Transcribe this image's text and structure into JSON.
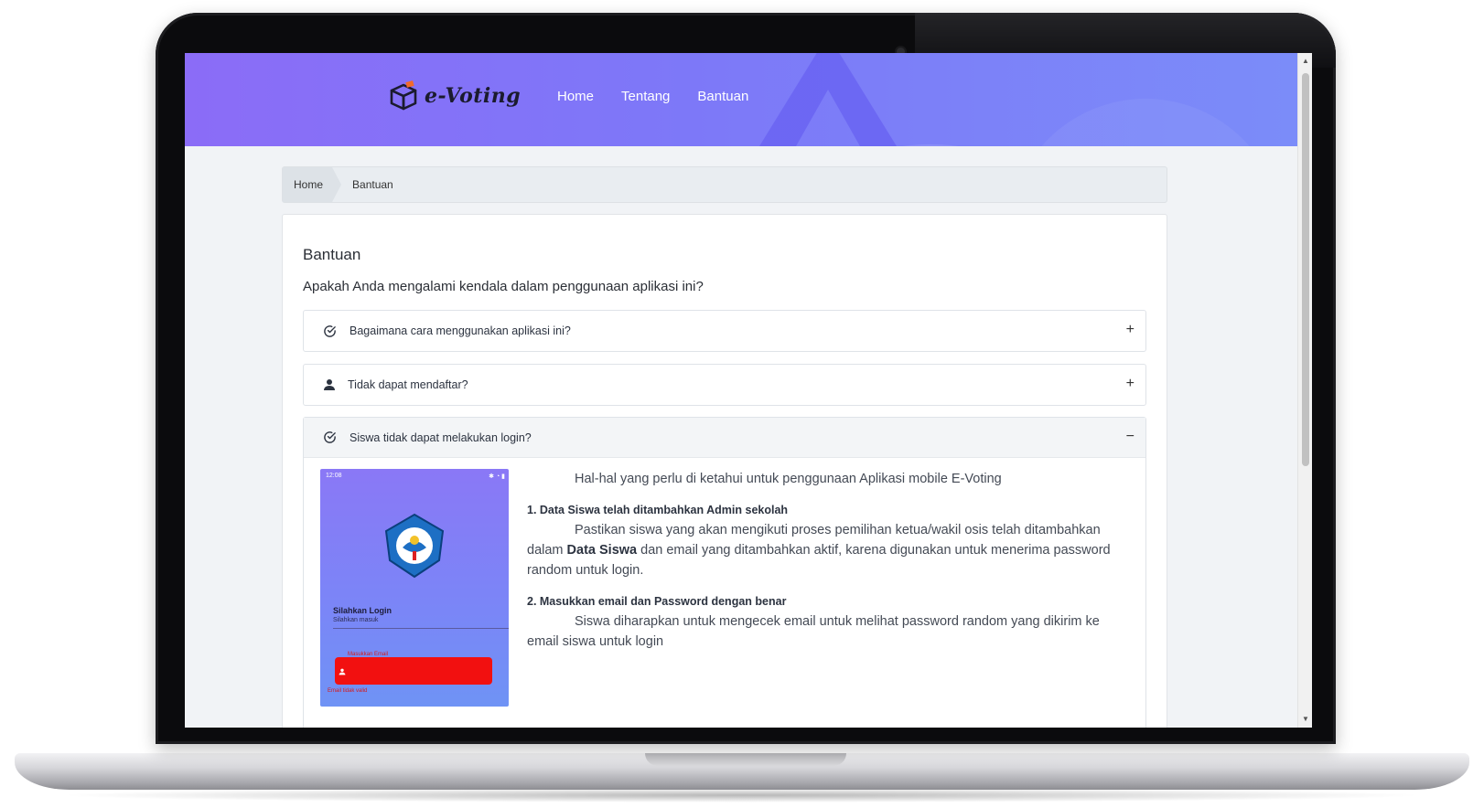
{
  "brand": {
    "logo_text": "e-Voting"
  },
  "nav": {
    "items": [
      "Home",
      "Tentang",
      "Bantuan"
    ]
  },
  "breadcrumb": {
    "home": "Home",
    "current": "Bantuan"
  },
  "page": {
    "title": "Bantuan",
    "subtitle": "Apakah Anda mengalami kendala dalam penggunaan aplikasi ini?"
  },
  "faq": [
    {
      "icon": "check-circle-icon",
      "question": "Bagaimana cara menggunakan aplikasi ini?",
      "toggle": "+"
    },
    {
      "icon": "user-icon",
      "question": "Tidak dapat mendaftar?",
      "toggle": "+"
    },
    {
      "icon": "check-circle-icon",
      "question": "Siswa tidak dapat melakukan login?",
      "toggle": "−"
    }
  ],
  "faq_open": {
    "intro": "Hal-hal yang perlu di ketahui untuk penggunaan Aplikasi mobile E-Voting",
    "step1_title": "1. Data Siswa telah ditambahkan Admin sekolah",
    "step1_text_a": "Pastikan siswa yang akan mengikuti proses pemilihan ketua/wakil osis telah ditambahkan dalam",
    "step1_bold": "Data Siswa",
    "step1_text_b": "dan email yang ditambahkan aktif, karena digunakan untuk menerima password random untuk login.",
    "step2_title": "2. Masukkan email dan Password dengan benar",
    "step2_text": "Siswa diharapkan untuk mengecek email untuk melihat password random yang dikirim ke email siswa untuk login"
  },
  "phone": {
    "time": "12:08",
    "login_title": "Silahkan Login",
    "login_sub": "Silahkan masuk",
    "email_label": "Masukkan Email",
    "email_error": "Email tidak valid"
  },
  "colors": {
    "hero_start": "#8b6cf7",
    "hero_end": "#7b8cf9",
    "error_red": "#f21010"
  }
}
